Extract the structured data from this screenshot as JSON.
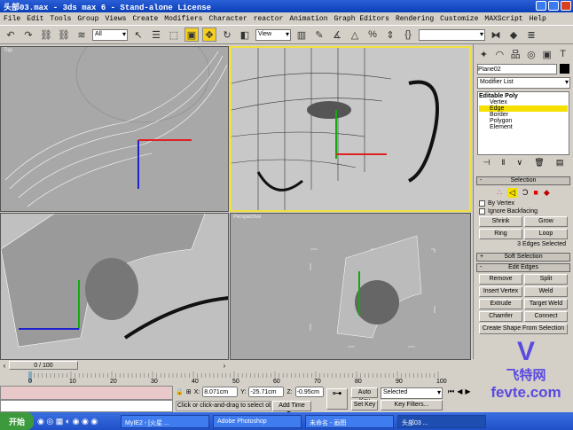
{
  "window": {
    "title": "头部03.max - 3ds max 6 - Stand-alone License"
  },
  "menu": [
    "File",
    "Edit",
    "Tools",
    "Group",
    "Views",
    "Create",
    "Modifiers",
    "Character",
    "reactor",
    "Animation",
    "Graph Editors",
    "Rendering",
    "Customize",
    "MAXScript",
    "Help"
  ],
  "toolbar": {
    "selection_filter": "All",
    "reference_coord": "View",
    "named_selection": ""
  },
  "viewports": {
    "top_left": "Top",
    "top_right": "",
    "bottom_left": "",
    "bottom_right": "Perspective"
  },
  "command_panel": {
    "object_name": "Plane02",
    "modifier_list": "Modifier List",
    "stack": [
      {
        "label": "Editable Poly",
        "level": 0
      },
      {
        "label": "Vertex",
        "level": 1
      },
      {
        "label": "Edge",
        "level": 1,
        "selected": true
      },
      {
        "label": "Border",
        "level": 1
      },
      {
        "label": "Polygon",
        "level": 1
      },
      {
        "label": "Element",
        "level": 1
      }
    ],
    "selection_rollout": {
      "title": "Selection",
      "by_vertex": "By Vertex",
      "ignore_backfacing": "Ignore Backfacing",
      "shrink": "Shrink",
      "grow": "Grow",
      "ring": "Ring",
      "loop": "Loop",
      "status": "3 Edges Selected"
    },
    "soft_selection": "Soft Selection",
    "edit_edges": {
      "title": "Edit Edges",
      "buttons": [
        "Remove",
        "Split",
        "Insert Vertex",
        "Weld",
        "Extrude",
        "Target Weld",
        "Chamfer",
        "Connect",
        "Create Shape From Selection"
      ]
    }
  },
  "timeline": {
    "frame": "0 / 100",
    "ticks": [
      "0",
      "10",
      "20",
      "30",
      "40",
      "50",
      "60",
      "70",
      "80",
      "90",
      "100"
    ]
  },
  "status": {
    "x": "8.071cm",
    "y": "-25.71cm",
    "z": "-0.95cm",
    "prompt": "Click or click-and-drag to select ob",
    "add_time_tag": "Add Time Tag",
    "auto_key": "Auto Key",
    "set_key": "Set Key",
    "key_mode": "Selected",
    "key_filters": "Key Filters..."
  },
  "taskbar": {
    "start": "开始",
    "tasks": [
      "MyIE2 - [火星 ...",
      "Adobe Photoshop",
      "未命名 - 画图",
      "头部03 ..."
    ]
  },
  "watermark": {
    "cn": "飞特网",
    "url": "fevte.com"
  },
  "colors": {
    "active_border": "#f0e040",
    "highlight": "#f5e000",
    "title": "#0a3fb8"
  }
}
